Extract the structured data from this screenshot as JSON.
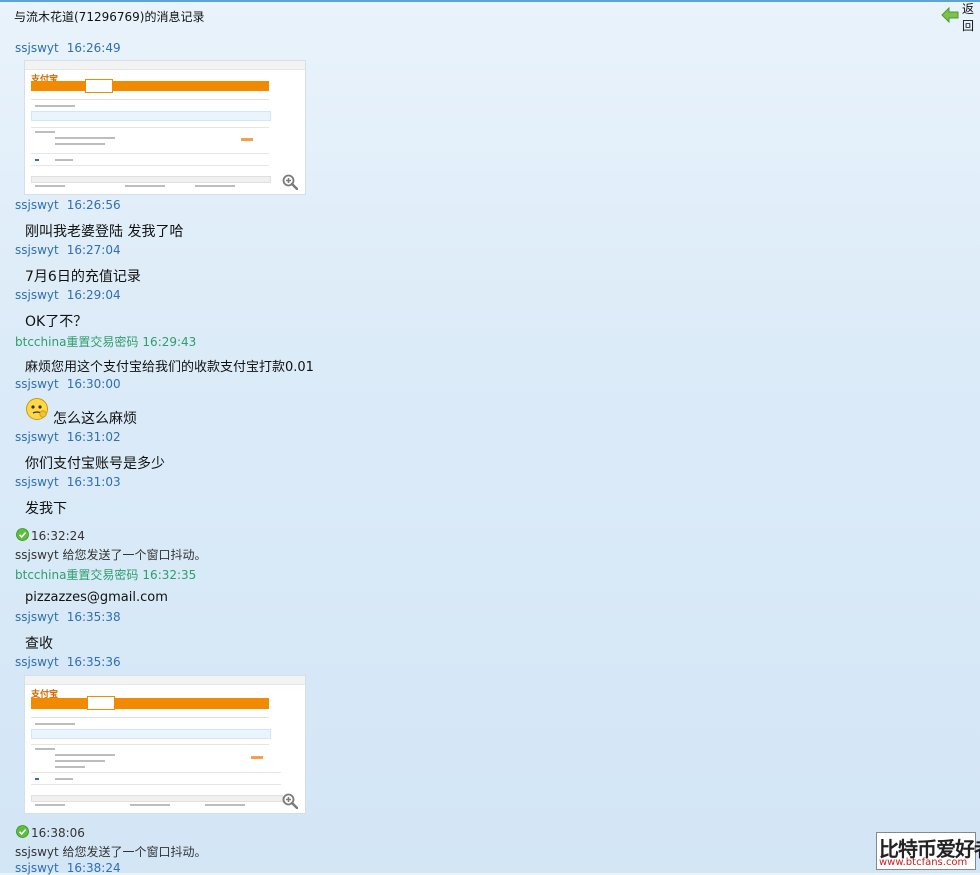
{
  "window": {
    "title": "与流木花道(71296769)的消息记录",
    "back_label": "返回"
  },
  "messages": [
    {
      "sender": "ssjswyt",
      "time": "16:26:49"
    },
    {
      "sender": "ssjswyt",
      "time": "16:26:56",
      "text": "刚叫我老婆登陆 发我了哈"
    },
    {
      "sender": "ssjswyt",
      "time": "16:27:04",
      "text": "7月6日的充值记录"
    },
    {
      "sender": "ssjswyt",
      "time": "16:29:04",
      "text": "OK了不？"
    },
    {
      "sender": "btcchina重置交易密码",
      "time": "16:29:43",
      "text": "麻烦您用这个支付宝给我们的收款支付宝打款0.01"
    },
    {
      "sender": "ssjswyt",
      "time": "16:30:00",
      "text": "怎么这么麻烦"
    },
    {
      "sender": "ssjswyt",
      "time": "16:31:02",
      "text": "你们支付宝账号是多少"
    },
    {
      "sender": "ssjswyt",
      "time": "16:31:03",
      "text": "发我下"
    },
    {
      "sender": "btcchina重置交易密码",
      "time": "16:32:35",
      "text": "pizzazzes@gmail.com"
    },
    {
      "sender": "ssjswyt",
      "time": "16:35:38",
      "text": "查收"
    },
    {
      "sender": "ssjswyt",
      "time": "16:35:36"
    },
    {
      "sender": "ssjswyt",
      "time": "16:38:24"
    }
  ],
  "system_events": [
    {
      "time": "16:32:24",
      "text": "ssjswyt 给您发送了一个窗口抖动。"
    },
    {
      "time": "16:38:06",
      "text": "ssjswyt 给您发送了一个窗口抖动。"
    }
  ],
  "watermark": {
    "brand": "比特币爱好者",
    "url": "www.btcfans.com"
  },
  "colors": {
    "sender_self": "#2f6fb3",
    "sender_other": "#2e9e6a",
    "accent": "#f18a00"
  },
  "icons": [
    "back-arrow-icon",
    "zoom-in-icon",
    "check-icon",
    "thinking-emoji-icon"
  ]
}
